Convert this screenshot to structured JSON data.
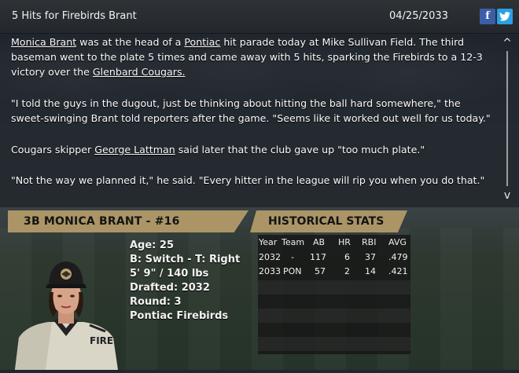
{
  "header": {
    "title": "5 Hits for Firebirds Brant",
    "date": "04/25/2033",
    "facebook_glyph": "f",
    "twitter_glyph": "t"
  },
  "article": {
    "p1": {
      "link_player": "Monica Brant",
      "t1": " was at the head of a ",
      "link_team": "Pontiac",
      "t2": " hit parade today at Mike Sullivan Field. The third baseman went to the plate 5 times and came away with 5 hits, sparking the Firebirds to a 12-3 victory over the ",
      "link_opponent": "Glenbard Cougars.",
      "t3": ""
    },
    "p2": "\"I told the guys in the dugout, just be thinking about hitting the ball hard somewhere,\" the sweet-swinging Brant told reporters after the game. \"Seems like it worked out well for us today.\"",
    "p3": {
      "t1": "Cougars skipper ",
      "link_manager": "George Lattman",
      "t2": " said later that the club gave up \"too much plate.\""
    },
    "p4": "\"Not the way we planned it,\" he said. \"Every hitter in the league will rip you when you do that.\"",
    "scroll_up": "^",
    "scroll_down": "v"
  },
  "player": {
    "header": "3B MONICA BRANT - #16",
    "age": "Age: 25",
    "bats_throws": "B: Switch - T: Right",
    "height_weight": "5' 9\" / 140 lbs",
    "drafted": "Drafted: 2032",
    "round": "Round: 3",
    "team": "Pontiac Firebirds",
    "jersey_lettering": "FIRE"
  },
  "historical": {
    "header": "HISTORICAL STATS",
    "columns": [
      "Year",
      "Team",
      "AB",
      "HR",
      "RBI",
      "AVG"
    ],
    "rows": [
      [
        "2032",
        "-",
        "117",
        "6",
        "37",
        ".479"
      ],
      [
        "2033",
        "PON",
        "57",
        "2",
        "14",
        ".421"
      ]
    ]
  },
  "colors": {
    "accent_gold": "#ab9566",
    "facebook": "#3b5ea8",
    "twitter": "#2b9fe6"
  }
}
